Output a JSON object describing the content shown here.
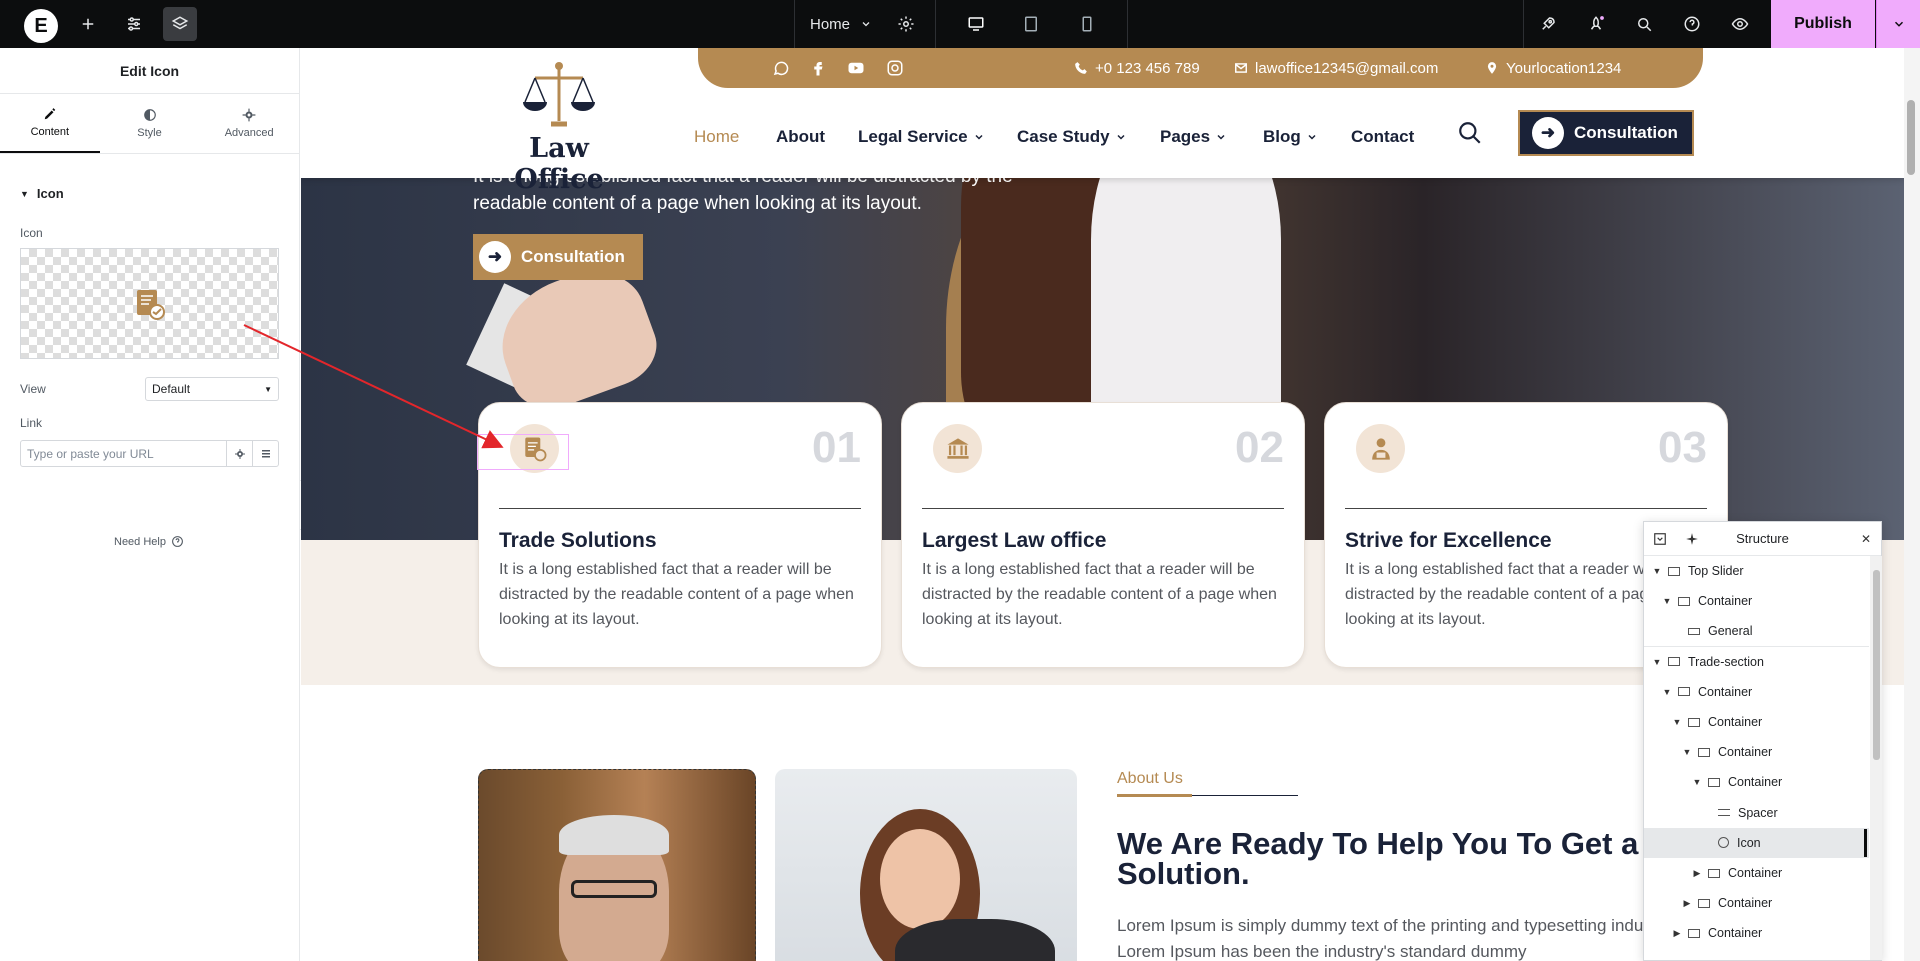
{
  "topbar": {
    "logo": "E",
    "page_name": "Home",
    "publish_label": "Publish"
  },
  "panel": {
    "title": "Edit Icon",
    "tabs": [
      {
        "label": "Content",
        "active": true
      },
      {
        "label": "Style",
        "active": false
      },
      {
        "label": "Advanced",
        "active": false
      }
    ],
    "section_title": "Icon",
    "icon_label": "Icon",
    "view_label": "View",
    "view_value": "Default",
    "link_label": "Link",
    "link_placeholder": "Type or paste your URL",
    "need_help": "Need Help"
  },
  "site": {
    "phone": "+0 123 456 789",
    "email": "lawoffice12345@gmail.com",
    "location": "Yourlocation1234",
    "brand": "Law Office",
    "nav": [
      {
        "label": "Home",
        "active": true,
        "dropdown": false
      },
      {
        "label": "About",
        "active": false,
        "dropdown": false
      },
      {
        "label": "Legal Service",
        "active": false,
        "dropdown": true
      },
      {
        "label": "Case Study",
        "active": false,
        "dropdown": true
      },
      {
        "label": "Pages",
        "active": false,
        "dropdown": true
      },
      {
        "label": "Blog",
        "active": false,
        "dropdown": true
      },
      {
        "label": "Contact",
        "active": false,
        "dropdown": false
      }
    ],
    "cta_label": "Consultation",
    "hero_text": "It is a long established fact that a reader will be distracted by the readable content of a page when looking at its layout.",
    "hero_btn": "Consultation",
    "cards": [
      {
        "num": "01",
        "title": "Trade Solutions",
        "desc": "It is a long established fact that a reader will be distracted by the readable content of a page when looking at its layout."
      },
      {
        "num": "02",
        "title": "Largest Law office",
        "desc": "It is a long established fact that a reader will be distracted by the readable content of a page when looking at its layout."
      },
      {
        "num": "03",
        "title": "Strive for Excellence",
        "desc": "It is a long established fact that a reader will be distracted by the readable content of a page when looking at its layout."
      }
    ],
    "about_tag": "About Us",
    "about_heading": "We Are Ready To Help You To Get a Solution.",
    "about_body": "Lorem Ipsum is simply dummy text of the printing and typesetting industry. Lorem Ipsum has been the industry's standard dummy"
  },
  "structure": {
    "title": "Structure",
    "items": [
      {
        "label": "Top Slider",
        "depth": 0,
        "arrow": "down",
        "kind": "section"
      },
      {
        "label": "Container",
        "depth": 1,
        "arrow": "down",
        "kind": "container"
      },
      {
        "label": "General",
        "depth": 2,
        "arrow": "",
        "kind": "widget"
      },
      {
        "label": "Trade-section",
        "depth": 0,
        "arrow": "down",
        "kind": "section"
      },
      {
        "label": "Container",
        "depth": 1,
        "arrow": "down",
        "kind": "container"
      },
      {
        "label": "Container",
        "depth": 2,
        "arrow": "down",
        "kind": "container"
      },
      {
        "label": "Container",
        "depth": 3,
        "arrow": "down",
        "kind": "container"
      },
      {
        "label": "Container",
        "depth": 4,
        "arrow": "down",
        "kind": "container"
      },
      {
        "label": "Spacer",
        "depth": 5,
        "arrow": "",
        "kind": "spacer"
      },
      {
        "label": "Icon",
        "depth": 5,
        "arrow": "",
        "kind": "icon",
        "selected": true
      },
      {
        "label": "Container",
        "depth": 4,
        "arrow": "right",
        "kind": "container"
      },
      {
        "label": "Container",
        "depth": 3,
        "arrow": "right",
        "kind": "container"
      },
      {
        "label": "Container",
        "depth": 2,
        "arrow": "right",
        "kind": "container"
      }
    ]
  },
  "colors": {
    "gold": "#b58a52",
    "navy": "#1a2238",
    "publish": "#f0abfc"
  }
}
